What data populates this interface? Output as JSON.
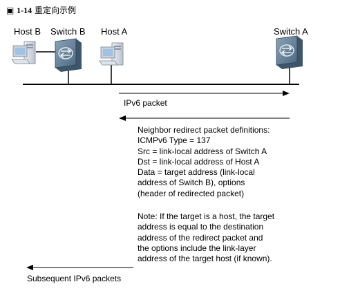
{
  "figure": {
    "number": "1-14",
    "title": "重定向示例"
  },
  "devices": {
    "host_b": "Host B",
    "switch_b": "Switch B",
    "host_a": "Host A",
    "switch_a": "Switch A"
  },
  "arrows": {
    "ipv6_packet": "IPv6 packet",
    "subsequent": "Subsequent IPv6 packets"
  },
  "definitions": {
    "lines": [
      "Neighbor redirect packet definitions:",
      "ICMPv6 Type = 137",
      "Src = link-local address of Switch A",
      "Dst = link-local address of Host A",
      "Data = target address (link-local",
      "address of Switch B), options",
      "(header of redirected packet)"
    ]
  },
  "note": {
    "lines": [
      "Note: If the target is a host, the target",
      "address is equal to the destination",
      "address of the redirect packet and",
      "the options include the link-layer",
      "address of the target host (if known)."
    ]
  },
  "colors": {
    "device_body": "#5f7f97",
    "device_dark": "#3d566b",
    "pc_screen": "#9ec3e6",
    "pc_body": "#d8dde3"
  }
}
